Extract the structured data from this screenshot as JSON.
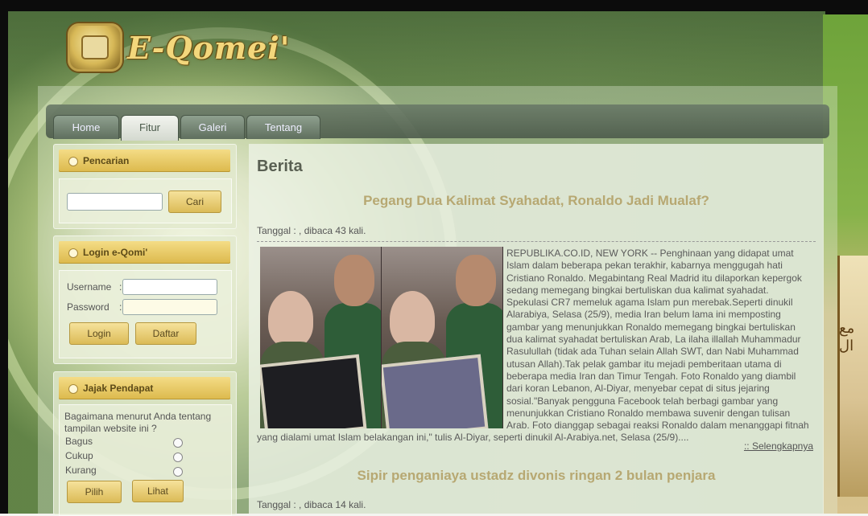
{
  "brand": {
    "name": "E-Qomei'"
  },
  "nav": {
    "tabs": [
      {
        "label": "Home"
      },
      {
        "label": "Fitur"
      },
      {
        "label": "Galeri"
      },
      {
        "label": "Tentang"
      }
    ],
    "active": "Fitur"
  },
  "search": {
    "title": "Pencarian",
    "input_value": "",
    "button": "Cari"
  },
  "login": {
    "title": "Login e-Qomi'",
    "username_label": "Username",
    "password_label": "Password",
    "username_sep": ":",
    "password_sep": ":",
    "login_button": "Login",
    "register_button": "Daftar"
  },
  "poll": {
    "title": "Jajak Pendapat",
    "question": "Bagaimana menurut Anda tentang tampilan website ini ?",
    "options": [
      "Bagus",
      "Cukup",
      "Kurang"
    ],
    "vote_button": "Pilih",
    "view_button": "Lihat"
  },
  "main": {
    "section_title": "Berita",
    "articles": [
      {
        "title": "Pegang Dua Kalimat Syahadat, Ronaldo Jadi Mualaf?",
        "meta": "Tanggal : , dibaca 43 kali.",
        "body": "REPUBLIKA.CO.ID, NEW YORK -- Penghinaan yang didapat umat Islam dalam beberapa pekan terakhir, kabarnya menggugah hati Cristiano Ronaldo. Megabintang Real Madrid itu dilaporkan kepergok sedang memegang bingkai bertuliskan dua kalimat syahadat. Spekulasi CR7 memeluk agama Islam pun merebak.Seperti dinukil Alarabiya, Selasa (25/9), media Iran belum lama ini memposting gambar yang menunjukkan Ronaldo memegang bingkai bertuliskan dua kalimat syahadat bertuliskan Arab, La ilaha illallah Muhammadur Rasulullah (tidak ada Tuhan selain Allah SWT, dan Nabi Muhammad utusan Allah).Tak pelak gambar itu mejadi pemberitaan utama di beberapa media Iran dan Timur Tengah. Foto Ronaldo yang diambil dari koran Lebanon, Al-Diyar, menyebar cepat di situs jejaring sosial.\"Banyak pengguna Facebook telah berbagi gambar yang menunjukkan Cristiano Ronaldo membawa suvenir dengan tulisan Arab. Foto dianggap sebagai reaksi Ronaldo dalam menanggapi fitnah yang dialami umat Islam belakangan ini,\" tulis Al-Diyar, seperti dinukil Al-Arabiya.net, Selasa (25/9)....",
        "more": ":: Selengkapnya"
      },
      {
        "title": "Sipir penganiaya ustadz divonis ringan 2 bulan penjara",
        "meta": "Tanggal : , dibaca 14 kali."
      }
    ]
  },
  "colors": {
    "accent_gold": "#dcb94c",
    "title_gold": "#b7a872",
    "nav_dark": "#4c5a4b"
  }
}
